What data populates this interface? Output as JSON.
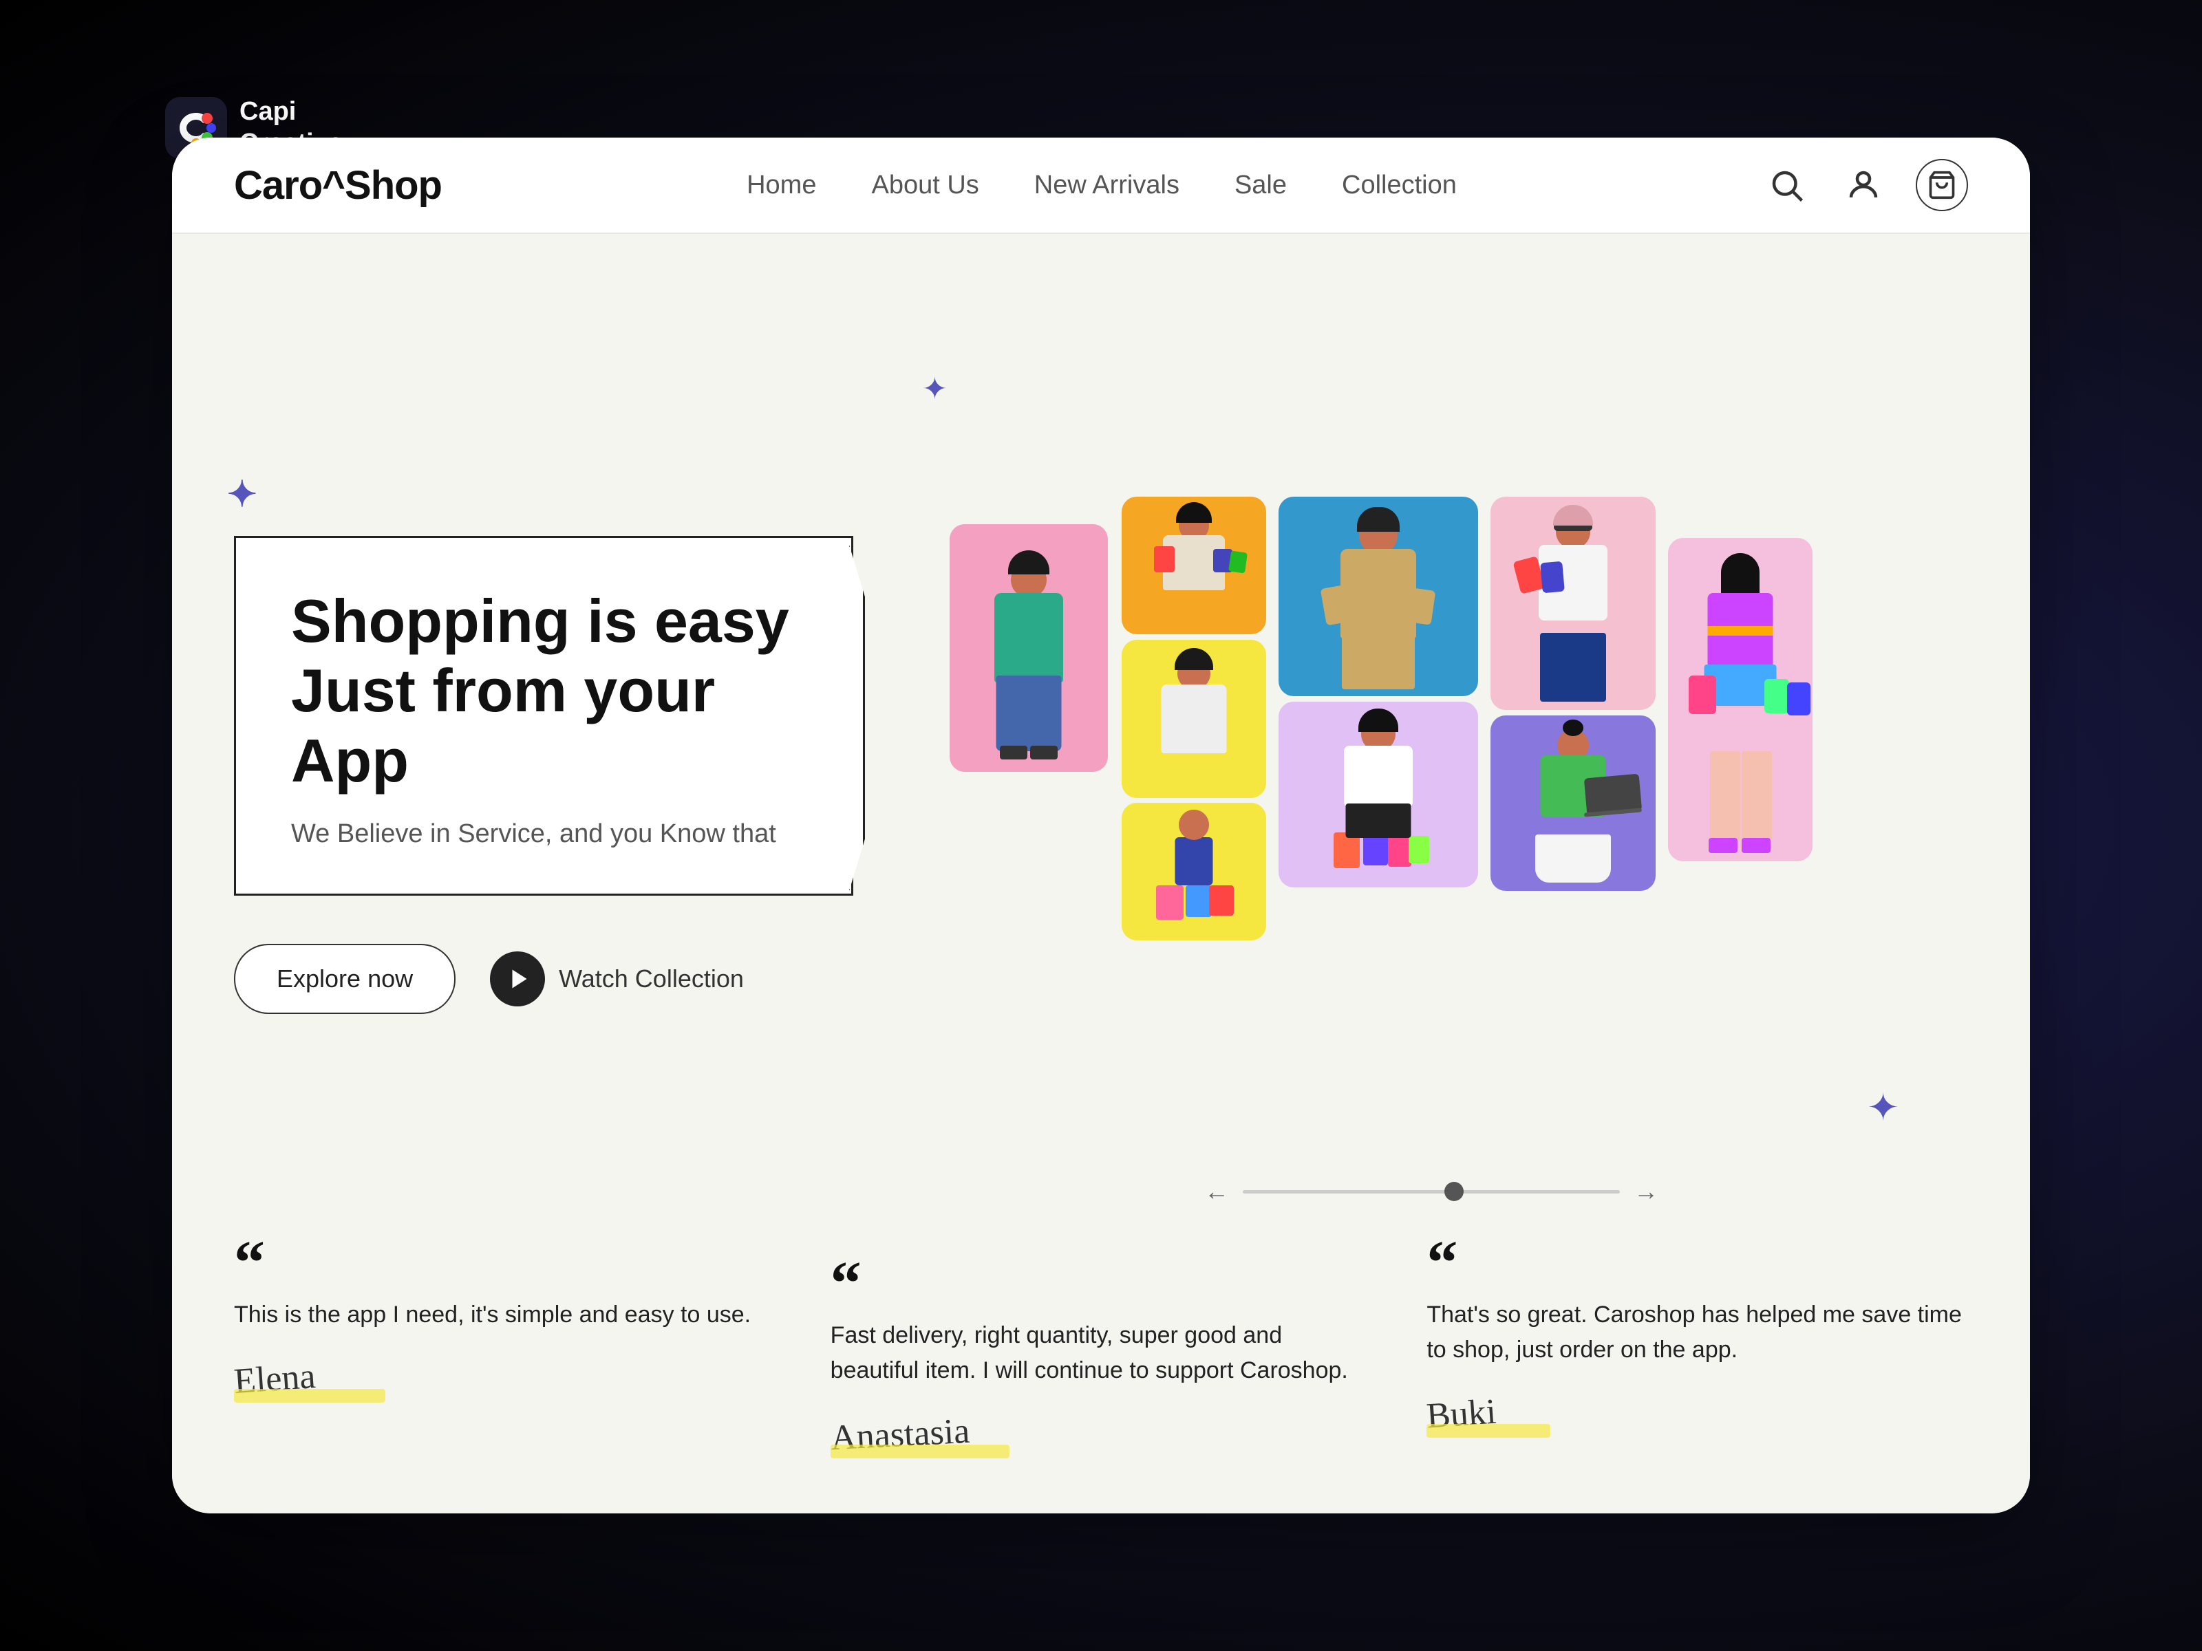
{
  "app": {
    "brand": "Capi\nCreative",
    "bg_color": "#0a0a2e"
  },
  "site": {
    "name": "Caro^Shop",
    "nav": {
      "links": [
        {
          "id": "home",
          "label": "Home"
        },
        {
          "id": "about",
          "label": "About Us"
        },
        {
          "id": "new-arrivals",
          "label": "New Arrivals"
        },
        {
          "id": "sale",
          "label": "Sale"
        },
        {
          "id": "collection",
          "label": "Collection"
        }
      ]
    }
  },
  "hero": {
    "title_line1": "Shopping is easy",
    "title_line2": "Just from your App",
    "subtitle": "We Believe in Service, and you Know that",
    "cta_explore": "Explore now",
    "cta_watch": "Watch Collection"
  },
  "testimonials": [
    {
      "id": "t1",
      "text": "This is the app I need, it's simple and easy to use.",
      "author_signature": "Elena"
    },
    {
      "id": "t2",
      "text": "Fast delivery, right quantity, super good and beautiful item. I will continue to support Caroshop.",
      "author_signature": "Anastasia"
    },
    {
      "id": "t3",
      "text": "That's so great. Caroshop has helped me save time to shop, just order on the app.",
      "author_signature": "Buki"
    }
  ],
  "images": [
    {
      "id": "img1",
      "bg": "#f4a0c0",
      "label": "Woman pink"
    },
    {
      "id": "img2",
      "bg": "#f5a623",
      "label": "Woman orange bags"
    },
    {
      "id": "img3",
      "bg": "#6ec0d8",
      "label": "Man blue"
    },
    {
      "id": "img4",
      "bg": "#f0c0d0",
      "label": "Woman pink shopping"
    },
    {
      "id": "img5",
      "bg": "#e0b0f0",
      "label": "Woman yellow bags"
    },
    {
      "id": "img6",
      "bg": "#e8d870",
      "label": "Woman yellow"
    },
    {
      "id": "img7",
      "bg": "#9988ee",
      "label": "Woman purple laptop"
    },
    {
      "id": "img8",
      "bg": "#f5c842",
      "label": "Boy yellow bags"
    },
    {
      "id": "img9",
      "bg": "#f5c842",
      "label": "Woman jumping"
    }
  ],
  "icons": {
    "search": "search-icon",
    "user": "user-icon",
    "cart": "cart-icon",
    "play": "play-icon",
    "arrow_left": "arrow-left-icon",
    "arrow_right": "arrow-right-icon",
    "quote": "“"
  }
}
